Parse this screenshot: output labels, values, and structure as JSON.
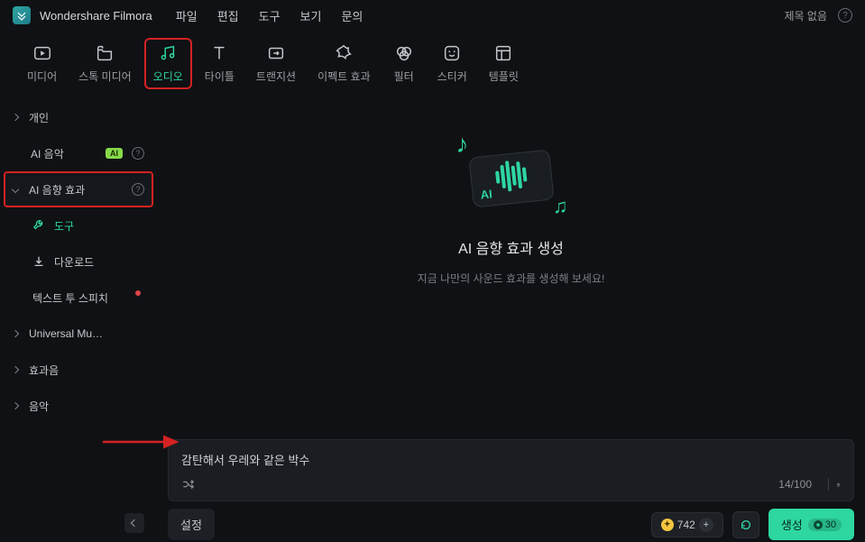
{
  "app": {
    "title": "Wondershare Filmora"
  },
  "menu": {
    "items": [
      "파일",
      "편집",
      "도구",
      "보기",
      "문의"
    ]
  },
  "titlebar_right": {
    "project_name": "제목 없음"
  },
  "toolbar": {
    "items": [
      {
        "label": "미디어"
      },
      {
        "label": "스톡 미디어"
      },
      {
        "label": "오디오"
      },
      {
        "label": "타이틀"
      },
      {
        "label": "트랜지션"
      },
      {
        "label": "이펙트 효과"
      },
      {
        "label": "필터"
      },
      {
        "label": "스티커"
      },
      {
        "label": "템플릿"
      }
    ]
  },
  "sidebar": {
    "items": [
      {
        "label": "개인"
      },
      {
        "label": "AI 음악",
        "badge": "AI",
        "help": true
      },
      {
        "label": "AI 음향 효과",
        "help": true
      },
      {
        "label": "도구"
      },
      {
        "label": "다운로드"
      },
      {
        "label": "텍스트 투 스피치"
      },
      {
        "label": "Universal Mu…"
      },
      {
        "label": "효과음"
      },
      {
        "label": "음악"
      }
    ]
  },
  "hero": {
    "ai_text": "AI",
    "title": "AI 음향 효과 생성",
    "subtitle": "지금 나만의 사운드 효과를 생성해 보세요!"
  },
  "prompt": {
    "text": "감탄해서 우레와 같은 박수",
    "counter": "14/100"
  },
  "bottom": {
    "settings_label": "설정",
    "credits": "742",
    "generate_label": "생성",
    "generate_cost": "30"
  }
}
